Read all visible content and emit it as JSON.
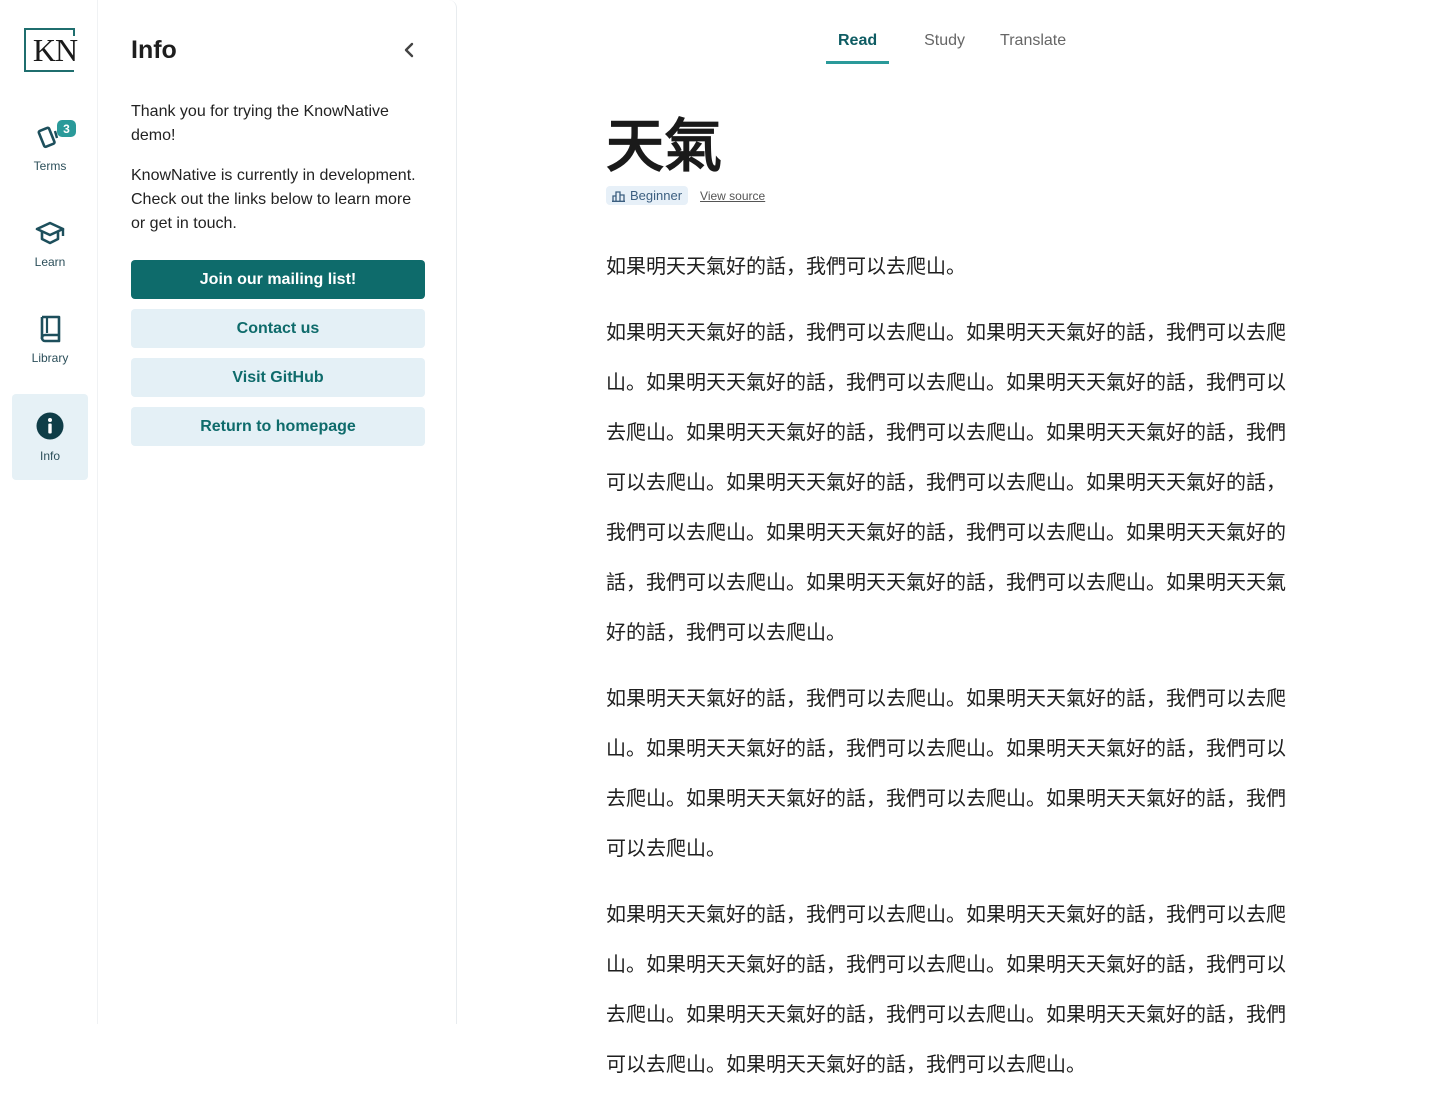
{
  "rail": {
    "logo": "KN",
    "items": [
      {
        "label": "Terms",
        "icon": "cards-icon",
        "badge": "3"
      },
      {
        "label": "Learn",
        "icon": "graduation-cap-icon"
      },
      {
        "label": "Library",
        "icon": "book-icon"
      },
      {
        "label": "Info",
        "icon": "info-icon",
        "active": true
      }
    ]
  },
  "panel": {
    "title": "Info",
    "intro": "Thank you for trying the KnowNative demo!",
    "body": "KnowNative is currently in development. Check out the links below to learn more or get in touch.",
    "buttons": [
      "Join our mailing list!",
      "Contact us",
      "Visit GitHub",
      "Return to homepage"
    ]
  },
  "tabs": [
    "Read",
    "Study",
    "Translate"
  ],
  "article": {
    "title": "天氣",
    "level": "Beginner",
    "source_link": "View source",
    "paragraphs": [
      "如果明天天氣好的話，我們可以去爬山。",
      "如果明天天氣好的話，我們可以去爬山。如果明天天氣好的話，我們可以去爬山。如果明天天氣好的話，我們可以去爬山。如果明天天氣好的話，我們可以去爬山。如果明天天氣好的話，我們可以去爬山。如果明天天氣好的話，我們可以去爬山。如果明天天氣好的話，我們可以去爬山。如果明天天氣好的話，我們可以去爬山。如果明天天氣好的話，我們可以去爬山。如果明天天氣好的話，我們可以去爬山。如果明天天氣好的話，我們可以去爬山。如果明天天氣好的話，我們可以去爬山。",
      "如果明天天氣好的話，我們可以去爬山。如果明天天氣好的話，我們可以去爬山。如果明天天氣好的話，我們可以去爬山。如果明天天氣好的話，我們可以去爬山。如果明天天氣好的話，我們可以去爬山。如果明天天氣好的話，我們可以去爬山。",
      "如果明天天氣好的話，我們可以去爬山。如果明天天氣好的話，我們可以去爬山。如果明天天氣好的話，我們可以去爬山。如果明天天氣好的話，我們可以去爬山。如果明天天氣好的話，我們可以去爬山。如果明天天氣好的話，我們可以去爬山。如果明天天氣好的話，我們可以去爬山。"
    ]
  },
  "colors": {
    "accent": "#0e6b6b",
    "accent_light": "#e4f0f6",
    "tab_underline": "#2a9a9a"
  }
}
